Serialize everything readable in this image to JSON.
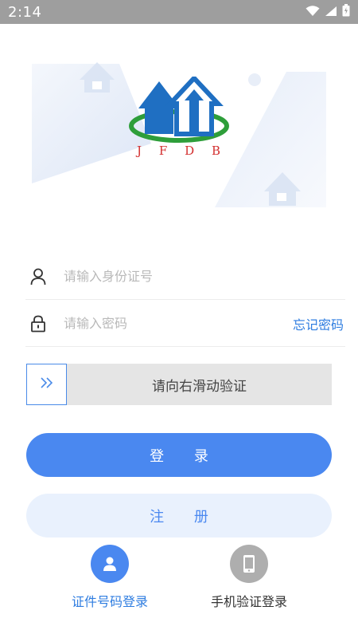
{
  "status_bar": {
    "time": "2:14",
    "icons": [
      "wifi-icon",
      "signal-icon",
      "battery-icon"
    ]
  },
  "logo": {
    "letters": [
      "J",
      "F",
      "D",
      "B"
    ]
  },
  "form": {
    "id_placeholder": "请输入身份证号",
    "password_placeholder": "请输入密码",
    "forgot_password": "忘记密码"
  },
  "slider": {
    "text": "请向右滑动验证",
    "handle_icon": "double-chevron-right-icon"
  },
  "buttons": {
    "login": "登 录",
    "register": "注 册"
  },
  "login_methods": [
    {
      "label": "证件号码登录",
      "icon": "person-icon",
      "active": true
    },
    {
      "label": "手机验证登录",
      "icon": "phone-icon",
      "active": false
    }
  ],
  "colors": {
    "primary": "#4a88f0",
    "primary_light": "#e9f1fd",
    "link": "#2f7de0",
    "logo_blue": "#1f6fc2",
    "logo_green": "#2e9e3a",
    "logo_red": "#d32f2f",
    "status_bar": "#9e9e9e"
  }
}
